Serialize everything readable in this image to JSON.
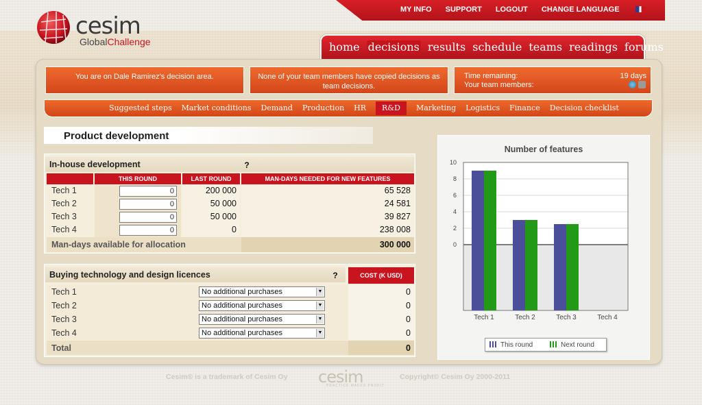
{
  "brand": {
    "name": "cesim",
    "sub_a": "Global",
    "sub_b": "Challenge"
  },
  "topbar": {
    "links": [
      "MY INFO",
      "SUPPORT",
      "LOGOUT",
      "CHANGE LANGUAGE"
    ]
  },
  "nav": {
    "tabs": [
      "home",
      "decisions",
      "results",
      "schedule",
      "teams",
      "readings",
      "forums"
    ],
    "active": "decisions"
  },
  "info": {
    "decision_area": "You are on Dale Ramirez's decision area.",
    "copied_line1": "None of your team members have copied decisions as",
    "copied_line2": "team decisions.",
    "time_label": "Time remaining:",
    "time_value": "19 days",
    "members_label": "Your team members:"
  },
  "subnav": {
    "items": [
      "Suggested steps",
      "Market conditions",
      "Demand",
      "Production",
      "HR",
      "R&D",
      "Marketing",
      "Logistics",
      "Finance",
      "Decision checklist"
    ],
    "active": "R&D"
  },
  "page": {
    "title": "Product development"
  },
  "inhouse": {
    "title": "In-house development",
    "columns": [
      "THIS ROUND",
      "LAST ROUND",
      "MAN-DAYS NEEDED FOR NEW FEATURES"
    ],
    "rows": [
      {
        "label": "Tech 1",
        "this_round": "0",
        "last_round": "200 000",
        "needed": "65 528"
      },
      {
        "label": "Tech 2",
        "this_round": "0",
        "last_round": "50 000",
        "needed": "24 581"
      },
      {
        "label": "Tech 3",
        "this_round": "0",
        "last_round": "50 000",
        "needed": "39 827"
      },
      {
        "label": "Tech 4",
        "this_round": "0",
        "last_round": "0",
        "needed": "238 008"
      }
    ],
    "available_label": "Man-days available for allocation",
    "available_value": "300 000"
  },
  "licences": {
    "title": "Buying technology and design licences",
    "cost_header": "COST (K USD)",
    "rows": [
      {
        "label": "Tech 1",
        "purchase": "No additional purchases",
        "cost": "0"
      },
      {
        "label": "Tech 2",
        "purchase": "No additional purchases",
        "cost": "0"
      },
      {
        "label": "Tech 3",
        "purchase": "No additional purchases",
        "cost": "0"
      },
      {
        "label": "Tech 4",
        "purchase": "No additional purchases",
        "cost": "0"
      }
    ],
    "total_label": "Total",
    "total_value": "0"
  },
  "chart_data": {
    "type": "bar",
    "title": "Number of features",
    "categories": [
      "Tech 1",
      "Tech 2",
      "Tech 3",
      "Tech 4"
    ],
    "series": [
      {
        "name": "This round",
        "values": [
          9,
          3,
          2.5,
          0
        ],
        "color": "#4b4f9a"
      },
      {
        "name": "Next round",
        "values": [
          9,
          3,
          2.5,
          0
        ],
        "color": "#229a17"
      }
    ],
    "yticks": [
      0,
      2,
      4,
      6,
      8,
      10
    ],
    "ylim": [
      -8,
      10
    ],
    "legend": "bottom"
  },
  "footer": {
    "trademark": "Cesim® is a trademark of Cesim Oy",
    "logo": "cesim",
    "tagline": "PRACTICE MAKES PROFIT",
    "copyright": "Copyright© Cesim Oy 2000-2011"
  },
  "colors": {
    "accent_red": "#c8141f",
    "accent_orange": "#e45a22"
  }
}
